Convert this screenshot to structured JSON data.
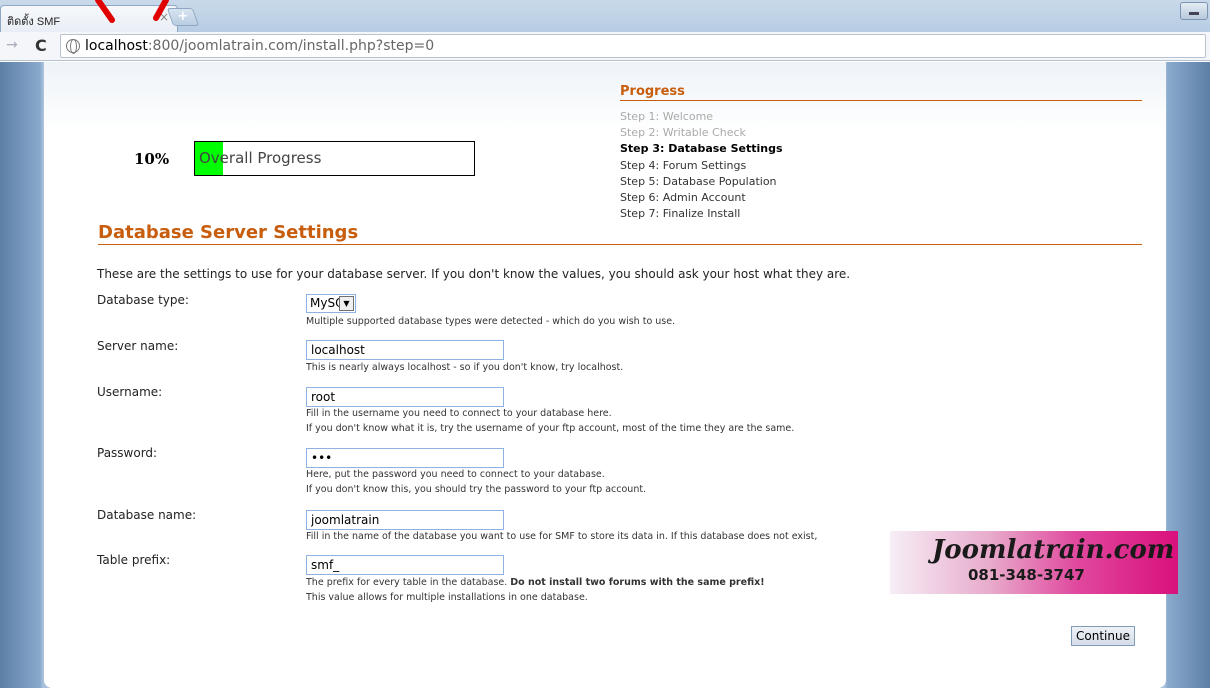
{
  "browser": {
    "tab_title": "ติดตั้ง SMF",
    "tab_close": "×",
    "new_tab": "+",
    "url_host": "localhost",
    "url_rest": ":800/joomlatrain.com/install.php?step=0"
  },
  "progress": {
    "heading": "Progress",
    "steps": [
      "Step 1: Welcome",
      "Step 2: Writable Check",
      "Step 3: Database Settings",
      "Step 4: Forum Settings",
      "Step 5: Database Population",
      "Step 6: Admin Account",
      "Step 7: Finalize Install"
    ],
    "current_step_index": 2,
    "overall_percent_label": "10%",
    "overall_fraction": 0.1,
    "overall_label": "Overall Progress",
    "bar_color": "#00ff00"
  },
  "form": {
    "title": "Database Server Settings",
    "intro": "These are the settings to use for your database server. If you don't know the values, you should ask your host what they are.",
    "db_type": {
      "label": "Database type:",
      "value": "MySQL",
      "hint": "Multiple supported database types were detected - which do you wish to use."
    },
    "server": {
      "label": "Server name:",
      "value": "localhost",
      "hint": "This is nearly always localhost - so if you don't know, try localhost."
    },
    "username": {
      "label": "Username:",
      "value": "root",
      "hint1": "Fill in the username you need to connect to your database here.",
      "hint2": "If you don't know what it is, try the username of your ftp account, most of the time they are the same."
    },
    "password": {
      "label": "Password:",
      "value": "•••",
      "hint1": "Here, put the password you need to connect to your database.",
      "hint2": "If you don't know this, you should try the password to your ftp account."
    },
    "db_name": {
      "label": "Database name:",
      "value": "joomlatrain",
      "hint": "Fill in the name of the database you want to use for SMF to store its data in. If this database does not exist,"
    },
    "prefix": {
      "label": "Table prefix:",
      "value": "smf_",
      "hint1_a": "The prefix for every table in the database. ",
      "hint1_b": "Do not install two forums with the same prefix!",
      "hint2": "This value allows for multiple installations in one database."
    },
    "continue_label": "Continue"
  },
  "banner": {
    "site": "Joomlatrain.com",
    "phone": "081-348-3747"
  },
  "colors": {
    "accent": "#c75d0d",
    "progress_fill": "#00ff00",
    "banner_pink": "#d9107c"
  }
}
